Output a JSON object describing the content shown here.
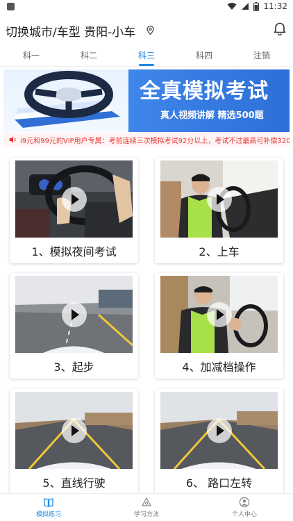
{
  "status_bar": {
    "time": "11:32"
  },
  "header": {
    "title": "切换城市/车型 贵阳-小车"
  },
  "tabs": [
    {
      "label": "科一",
      "active": false
    },
    {
      "label": "科二",
      "active": false
    },
    {
      "label": "科三",
      "active": true
    },
    {
      "label": "科四",
      "active": false
    },
    {
      "label": "注销",
      "active": false
    }
  ],
  "banner": {
    "title": "全真模拟考试",
    "subtitle": "真人视频讲解 精选500题"
  },
  "notice": {
    "text": "i9元和99元的VIP用户专属：考前连续三次模拟考试92分以上，考试不过最高可补偿320"
  },
  "videos": [
    {
      "label": "1、模拟夜间考试"
    },
    {
      "label": "2、上车"
    },
    {
      "label": "3、起步"
    },
    {
      "label": "4、加减档操作"
    },
    {
      "label": "5、直线行驶"
    },
    {
      "label": "6、 路口左转"
    }
  ],
  "bottom_nav": [
    {
      "label": "模拟练习",
      "icon": "book-icon",
      "active": true
    },
    {
      "label": "学习方法",
      "icon": "triangle-icon",
      "active": false
    },
    {
      "label": "个人中心",
      "icon": "person-icon",
      "active": false
    }
  ],
  "colors": {
    "accent": "#1e88e5",
    "notice": "#e53935",
    "banner": "#2d6fd8"
  }
}
